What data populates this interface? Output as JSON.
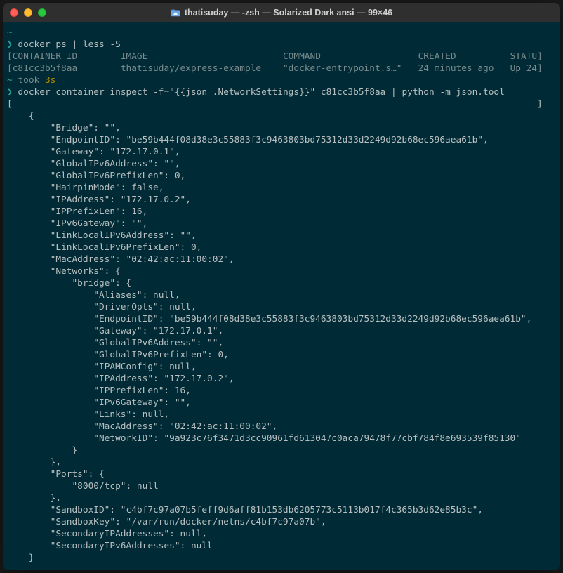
{
  "window": {
    "title": "thatisuday — -zsh — Solarized Dark ansi — 99×46"
  },
  "prompt": {
    "tilde": "~",
    "arrow": "❯",
    "took": "took ",
    "took_time": "3s"
  },
  "cmd1": "docker ps | less -S",
  "ps_header": {
    "c1": "CONTAINER ID",
    "c2": "IMAGE",
    "c3": "COMMAND",
    "c4": "CREATED",
    "c5": "STATU"
  },
  "ps_row": {
    "c1": "c81cc3b5f8aa",
    "c2": "thatisuday/express-example",
    "c3": "\"docker-entrypoint.s…\"",
    "c4": "24 minutes ago",
    "c5": "Up 24"
  },
  "cmd2": "docker container inspect -f=\"{{json .NetworkSettings}}\" c81cc3b5f8aa | python -m json.tool",
  "json": {
    "open": "[",
    "close": "]",
    "brace_open": "{",
    "brace_close": "}",
    "l01": "        \"Bridge\": \"\",",
    "l02": "        \"EndpointID\": \"be59b444f08d38e3c55883f3c9463803bd75312d33d2249d92b68ec596aea61b\",",
    "l03": "        \"Gateway\": \"172.17.0.1\",",
    "l04": "        \"GlobalIPv6Address\": \"\",",
    "l05": "        \"GlobalIPv6PrefixLen\": 0,",
    "l06": "        \"HairpinMode\": false,",
    "l07": "        \"IPAddress\": \"172.17.0.2\",",
    "l08": "        \"IPPrefixLen\": 16,",
    "l09": "        \"IPv6Gateway\": \"\",",
    "l10": "        \"LinkLocalIPv6Address\": \"\",",
    "l11": "        \"LinkLocalIPv6PrefixLen\": 0,",
    "l12": "        \"MacAddress\": \"02:42:ac:11:00:02\",",
    "l13": "        \"Networks\": {",
    "l14": "            \"bridge\": {",
    "l15": "                \"Aliases\": null,",
    "l16": "                \"DriverOpts\": null,",
    "l17": "                \"EndpointID\": \"be59b444f08d38e3c55883f3c9463803bd75312d33d2249d92b68ec596aea61b\",",
    "l18": "                \"Gateway\": \"172.17.0.1\",",
    "l19": "                \"GlobalIPv6Address\": \"\",",
    "l20": "                \"GlobalIPv6PrefixLen\": 0,",
    "l21": "                \"IPAMConfig\": null,",
    "l22": "                \"IPAddress\": \"172.17.0.2\",",
    "l23": "                \"IPPrefixLen\": 16,",
    "l24": "                \"IPv6Gateway\": \"\",",
    "l25": "                \"Links\": null,",
    "l26": "                \"MacAddress\": \"02:42:ac:11:00:02\",",
    "l27": "                \"NetworkID\": \"9a923c76f3471d3cc90961fd613047c0aca79478f77cbf784f8e693539f85130\"",
    "l28": "            }",
    "l29": "        },",
    "l30": "        \"Ports\": {",
    "l31": "            \"8000/tcp\": null",
    "l32": "        },",
    "l33": "        \"SandboxID\": \"c4bf7c97a07b5feff9d6aff81b153db6205773c5113b017f4c365b3d62e85b3c\",",
    "l34": "        \"SandboxKey\": \"/var/run/docker/netns/c4bf7c97a07b\",",
    "l35": "        \"SecondaryIPAddresses\": null,",
    "l36": "        \"SecondaryIPv6Addresses\": null",
    "l37": "    }"
  }
}
